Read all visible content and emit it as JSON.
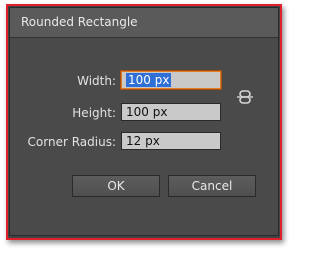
{
  "window": {
    "title": "Rounded Rectangle"
  },
  "fields": {
    "width": {
      "label": "Width:",
      "value": "100 px"
    },
    "height": {
      "label": "Height:",
      "value": "100 px"
    },
    "corner_radius": {
      "label": "Corner Radius:",
      "value": "12 px"
    }
  },
  "buttons": {
    "ok_label": "OK",
    "cancel_label": "Cancel"
  },
  "icons": {
    "constrain": "link-icon"
  },
  "colors": {
    "frame": "#e0202a",
    "dialog_bg": "#4a4a4a",
    "focus_border": "#e37c24",
    "selection": "#2f6fd6"
  }
}
